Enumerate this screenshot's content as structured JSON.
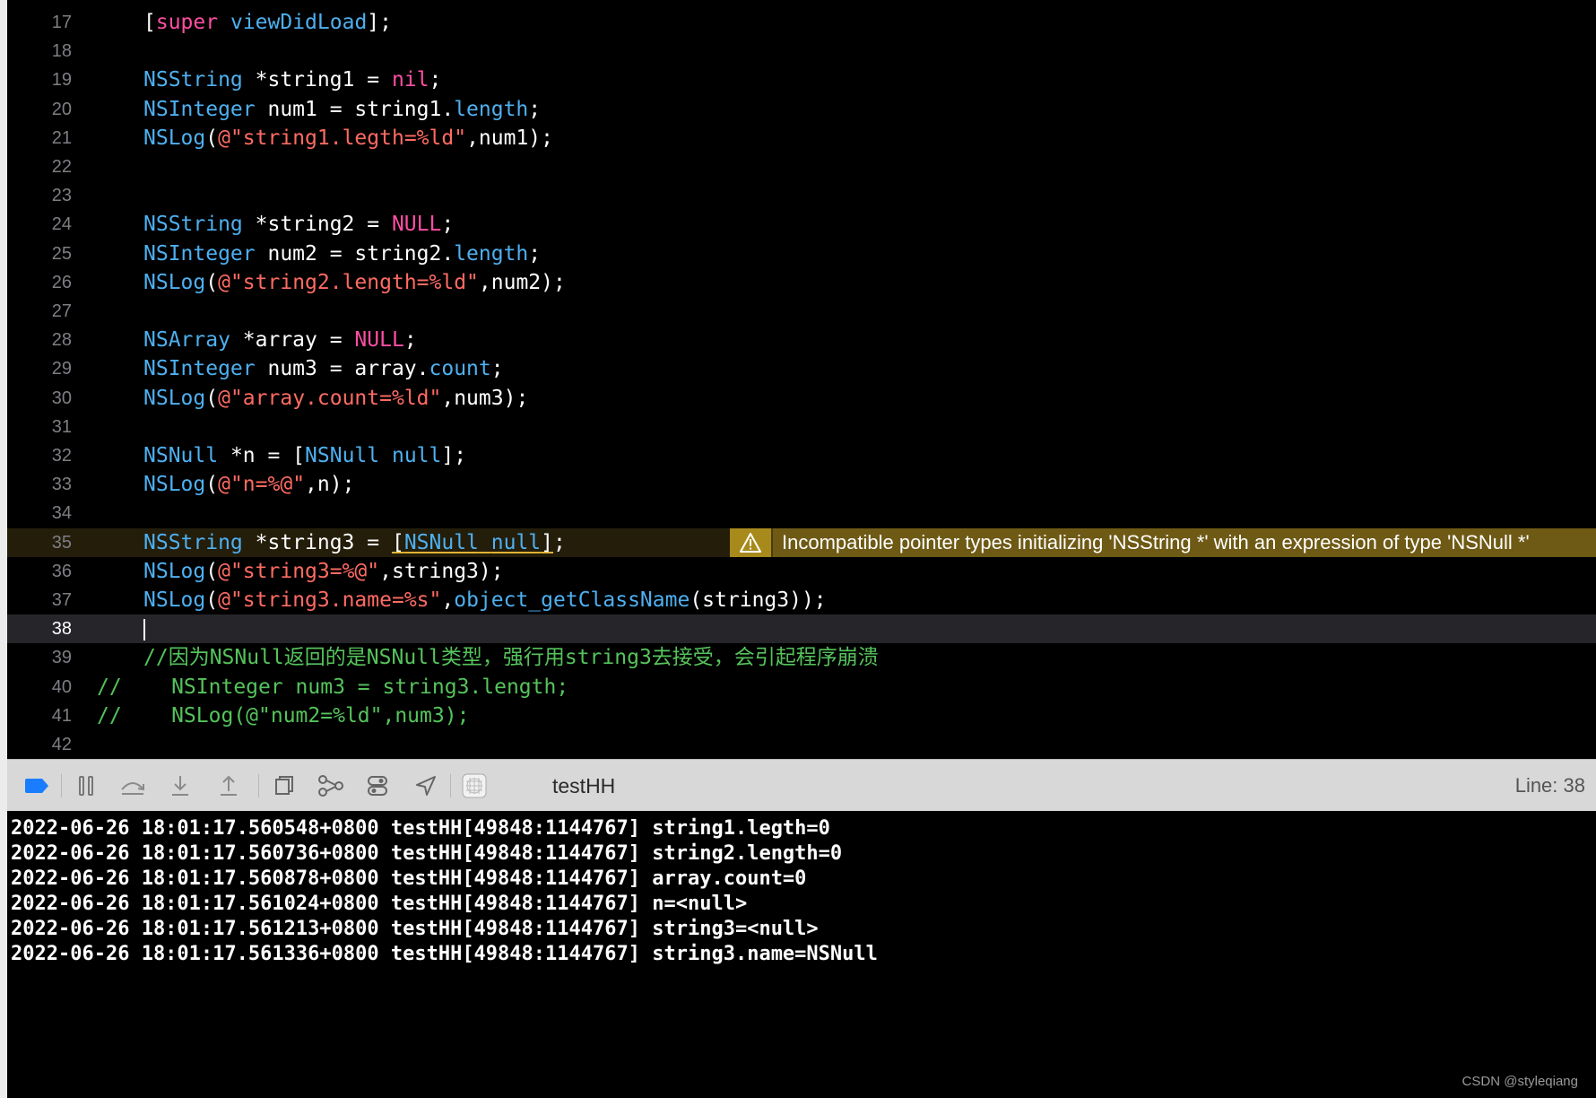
{
  "editor": {
    "lines": [
      {
        "num": "17",
        "tokens": [
          [
            "plain",
            "["
          ],
          [
            "kw",
            "super"
          ],
          [
            "plain",
            " "
          ],
          [
            "func",
            "viewDidLoad"
          ],
          [
            "plain",
            "];"
          ]
        ]
      },
      {
        "num": "18",
        "tokens": []
      },
      {
        "num": "19",
        "tokens": [
          [
            "type",
            "NSString"
          ],
          [
            "plain",
            " *string1 = "
          ],
          [
            "kw",
            "nil"
          ],
          [
            "plain",
            ";"
          ]
        ]
      },
      {
        "num": "20",
        "tokens": [
          [
            "type",
            "NSInteger"
          ],
          [
            "plain",
            " num1 = string1."
          ],
          [
            "prop",
            "length"
          ],
          [
            "plain",
            ";"
          ]
        ]
      },
      {
        "num": "21",
        "tokens": [
          [
            "func",
            "NSLog"
          ],
          [
            "plain",
            "("
          ],
          [
            "str",
            "@\"string1.legth=%ld\""
          ],
          [
            "plain",
            ",num1);"
          ]
        ]
      },
      {
        "num": "22",
        "tokens": []
      },
      {
        "num": "23",
        "tokens": []
      },
      {
        "num": "24",
        "tokens": [
          [
            "type",
            "NSString"
          ],
          [
            "plain",
            " *string2 = "
          ],
          [
            "kw",
            "NULL"
          ],
          [
            "plain",
            ";"
          ]
        ]
      },
      {
        "num": "25",
        "tokens": [
          [
            "type",
            "NSInteger"
          ],
          [
            "plain",
            " num2 = string2."
          ],
          [
            "prop",
            "length"
          ],
          [
            "plain",
            ";"
          ]
        ]
      },
      {
        "num": "26",
        "tokens": [
          [
            "func",
            "NSLog"
          ],
          [
            "plain",
            "("
          ],
          [
            "str",
            "@\"string2.length=%ld\""
          ],
          [
            "plain",
            ",num2);"
          ]
        ]
      },
      {
        "num": "27",
        "tokens": []
      },
      {
        "num": "28",
        "tokens": [
          [
            "type",
            "NSArray"
          ],
          [
            "plain",
            " *array = "
          ],
          [
            "kw",
            "NULL"
          ],
          [
            "plain",
            ";"
          ]
        ]
      },
      {
        "num": "29",
        "tokens": [
          [
            "type",
            "NSInteger"
          ],
          [
            "plain",
            " num3 = array."
          ],
          [
            "prop",
            "count"
          ],
          [
            "plain",
            ";"
          ]
        ]
      },
      {
        "num": "30",
        "tokens": [
          [
            "func",
            "NSLog"
          ],
          [
            "plain",
            "("
          ],
          [
            "str",
            "@\"array.count=%ld\""
          ],
          [
            "plain",
            ",num3);"
          ]
        ]
      },
      {
        "num": "31",
        "tokens": []
      },
      {
        "num": "32",
        "tokens": [
          [
            "type",
            "NSNull"
          ],
          [
            "plain",
            " *n = ["
          ],
          [
            "type",
            "NSNull"
          ],
          [
            "plain",
            " "
          ],
          [
            "func",
            "null"
          ],
          [
            "plain",
            "];"
          ]
        ]
      },
      {
        "num": "33",
        "tokens": [
          [
            "func",
            "NSLog"
          ],
          [
            "plain",
            "("
          ],
          [
            "str",
            "@\"n=%@\""
          ],
          [
            "plain",
            ",n);"
          ]
        ]
      },
      {
        "num": "34",
        "tokens": []
      },
      {
        "num": "35",
        "warn": true,
        "tokens": [
          [
            "type",
            "NSString"
          ],
          [
            "plain",
            " *string3 = "
          ],
          [
            "squiggle",
            "[NSNull null]"
          ],
          [
            "plain",
            ";"
          ]
        ]
      },
      {
        "num": "36",
        "tokens": [
          [
            "func",
            "NSLog"
          ],
          [
            "plain",
            "("
          ],
          [
            "str",
            "@\"string3=%@\""
          ],
          [
            "plain",
            ",string3);"
          ]
        ]
      },
      {
        "num": "37",
        "tokens": [
          [
            "func",
            "NSLog"
          ],
          [
            "plain",
            "("
          ],
          [
            "str",
            "@\"string3.name=%s\""
          ],
          [
            "plain",
            ","
          ],
          [
            "func",
            "object_getClassName"
          ],
          [
            "plain",
            "(string3));"
          ]
        ]
      },
      {
        "num": "38",
        "current": true,
        "tokens": []
      },
      {
        "num": "39",
        "tokens": [
          [
            "comment",
            "//因为NSNull返回的是NSNull类型，强行用string3去接受，会引起程序崩溃"
          ]
        ]
      },
      {
        "num": "40",
        "tokens": [
          [
            "comment",
            "//    NSInteger num3 = string3.length;"
          ]
        ],
        "indent": "comment"
      },
      {
        "num": "41",
        "tokens": [
          [
            "comment",
            "//    NSLog(@\"num2=%ld\",num3);"
          ]
        ],
        "indent": "comment"
      },
      {
        "num": "42",
        "tokens": []
      }
    ],
    "warning": {
      "message": "Incompatible pointer types initializing 'NSString *' with an expression of type 'NSNull *'",
      "color": "#6e5a15"
    }
  },
  "debug_bar": {
    "process_name": "testHH",
    "line_indicator": "Line: 38",
    "accent": "#1a7dff"
  },
  "console": {
    "lines": [
      "2022-06-26 18:01:17.560548+0800 testHH[49848:1144767] string1.legth=0",
      "2022-06-26 18:01:17.560736+0800 testHH[49848:1144767] string2.length=0",
      "2022-06-26 18:01:17.560878+0800 testHH[49848:1144767] array.count=0",
      "2022-06-26 18:01:17.561024+0800 testHH[49848:1144767] n=<null>",
      "2022-06-26 18:01:17.561213+0800 testHH[49848:1144767] string3=<null>",
      "2022-06-26 18:01:17.561336+0800 testHH[49848:1144767] string3.name=NSNull"
    ]
  },
  "watermark": "CSDN @styleqiang"
}
